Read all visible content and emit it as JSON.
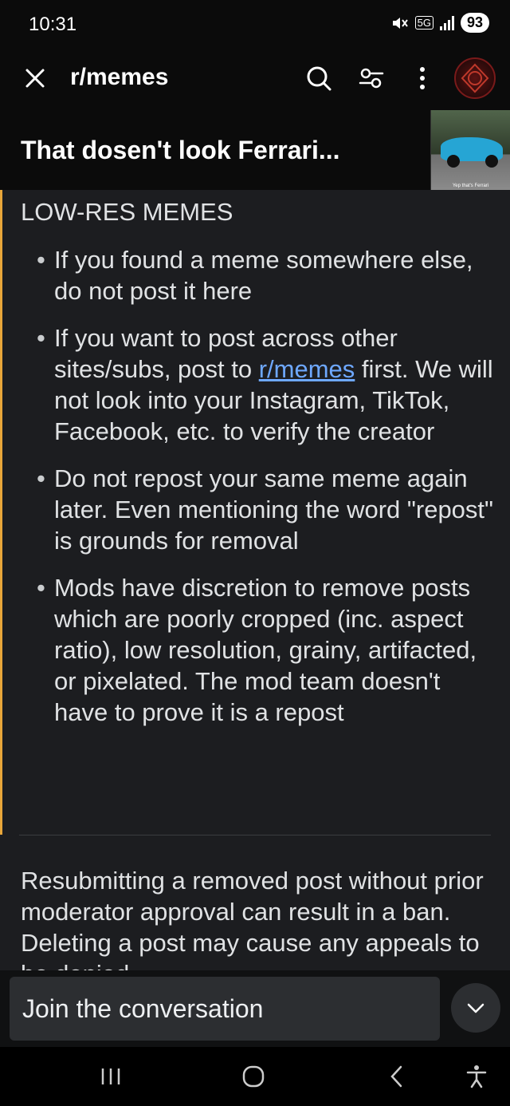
{
  "status_bar": {
    "time": "10:31",
    "network": "5G",
    "battery": "93"
  },
  "header": {
    "subreddit": "r/memes",
    "post_title": "That dosen't look Ferrari...",
    "thumbnail_caption": "Yep that's Ferrari"
  },
  "content": {
    "heading": "LOW-RES MEMES",
    "rules": [
      {
        "text": "If you found a meme somewhere else, do not post it here"
      },
      {
        "before_link": "If you want to post across other sites/subs, post to ",
        "link": "r/memes",
        "after_link": " first. We will not look into your Instagram, TikTok, Facebook, etc. to verify the creator"
      },
      {
        "text": "Do not repost your same meme again later. Even mentioning the word \"repost\" is grounds for removal"
      },
      {
        "text": "Mods have discretion to remove posts which are poorly cropped (inc. aspect ratio), low resolution, grainy, artifacted, or pixelated. The mod team doesn't have to prove it is a repost"
      }
    ],
    "paragraph": "Resubmitting a removed post without prior moderator approval can result in a ban. Deleting a post may cause any appeals to be denied."
  },
  "bottom": {
    "comment_placeholder": "Join the conversation"
  },
  "colors": {
    "quote_bar": "#e8a63a",
    "link": "#6ea8ff",
    "background": "#1c1d20"
  }
}
